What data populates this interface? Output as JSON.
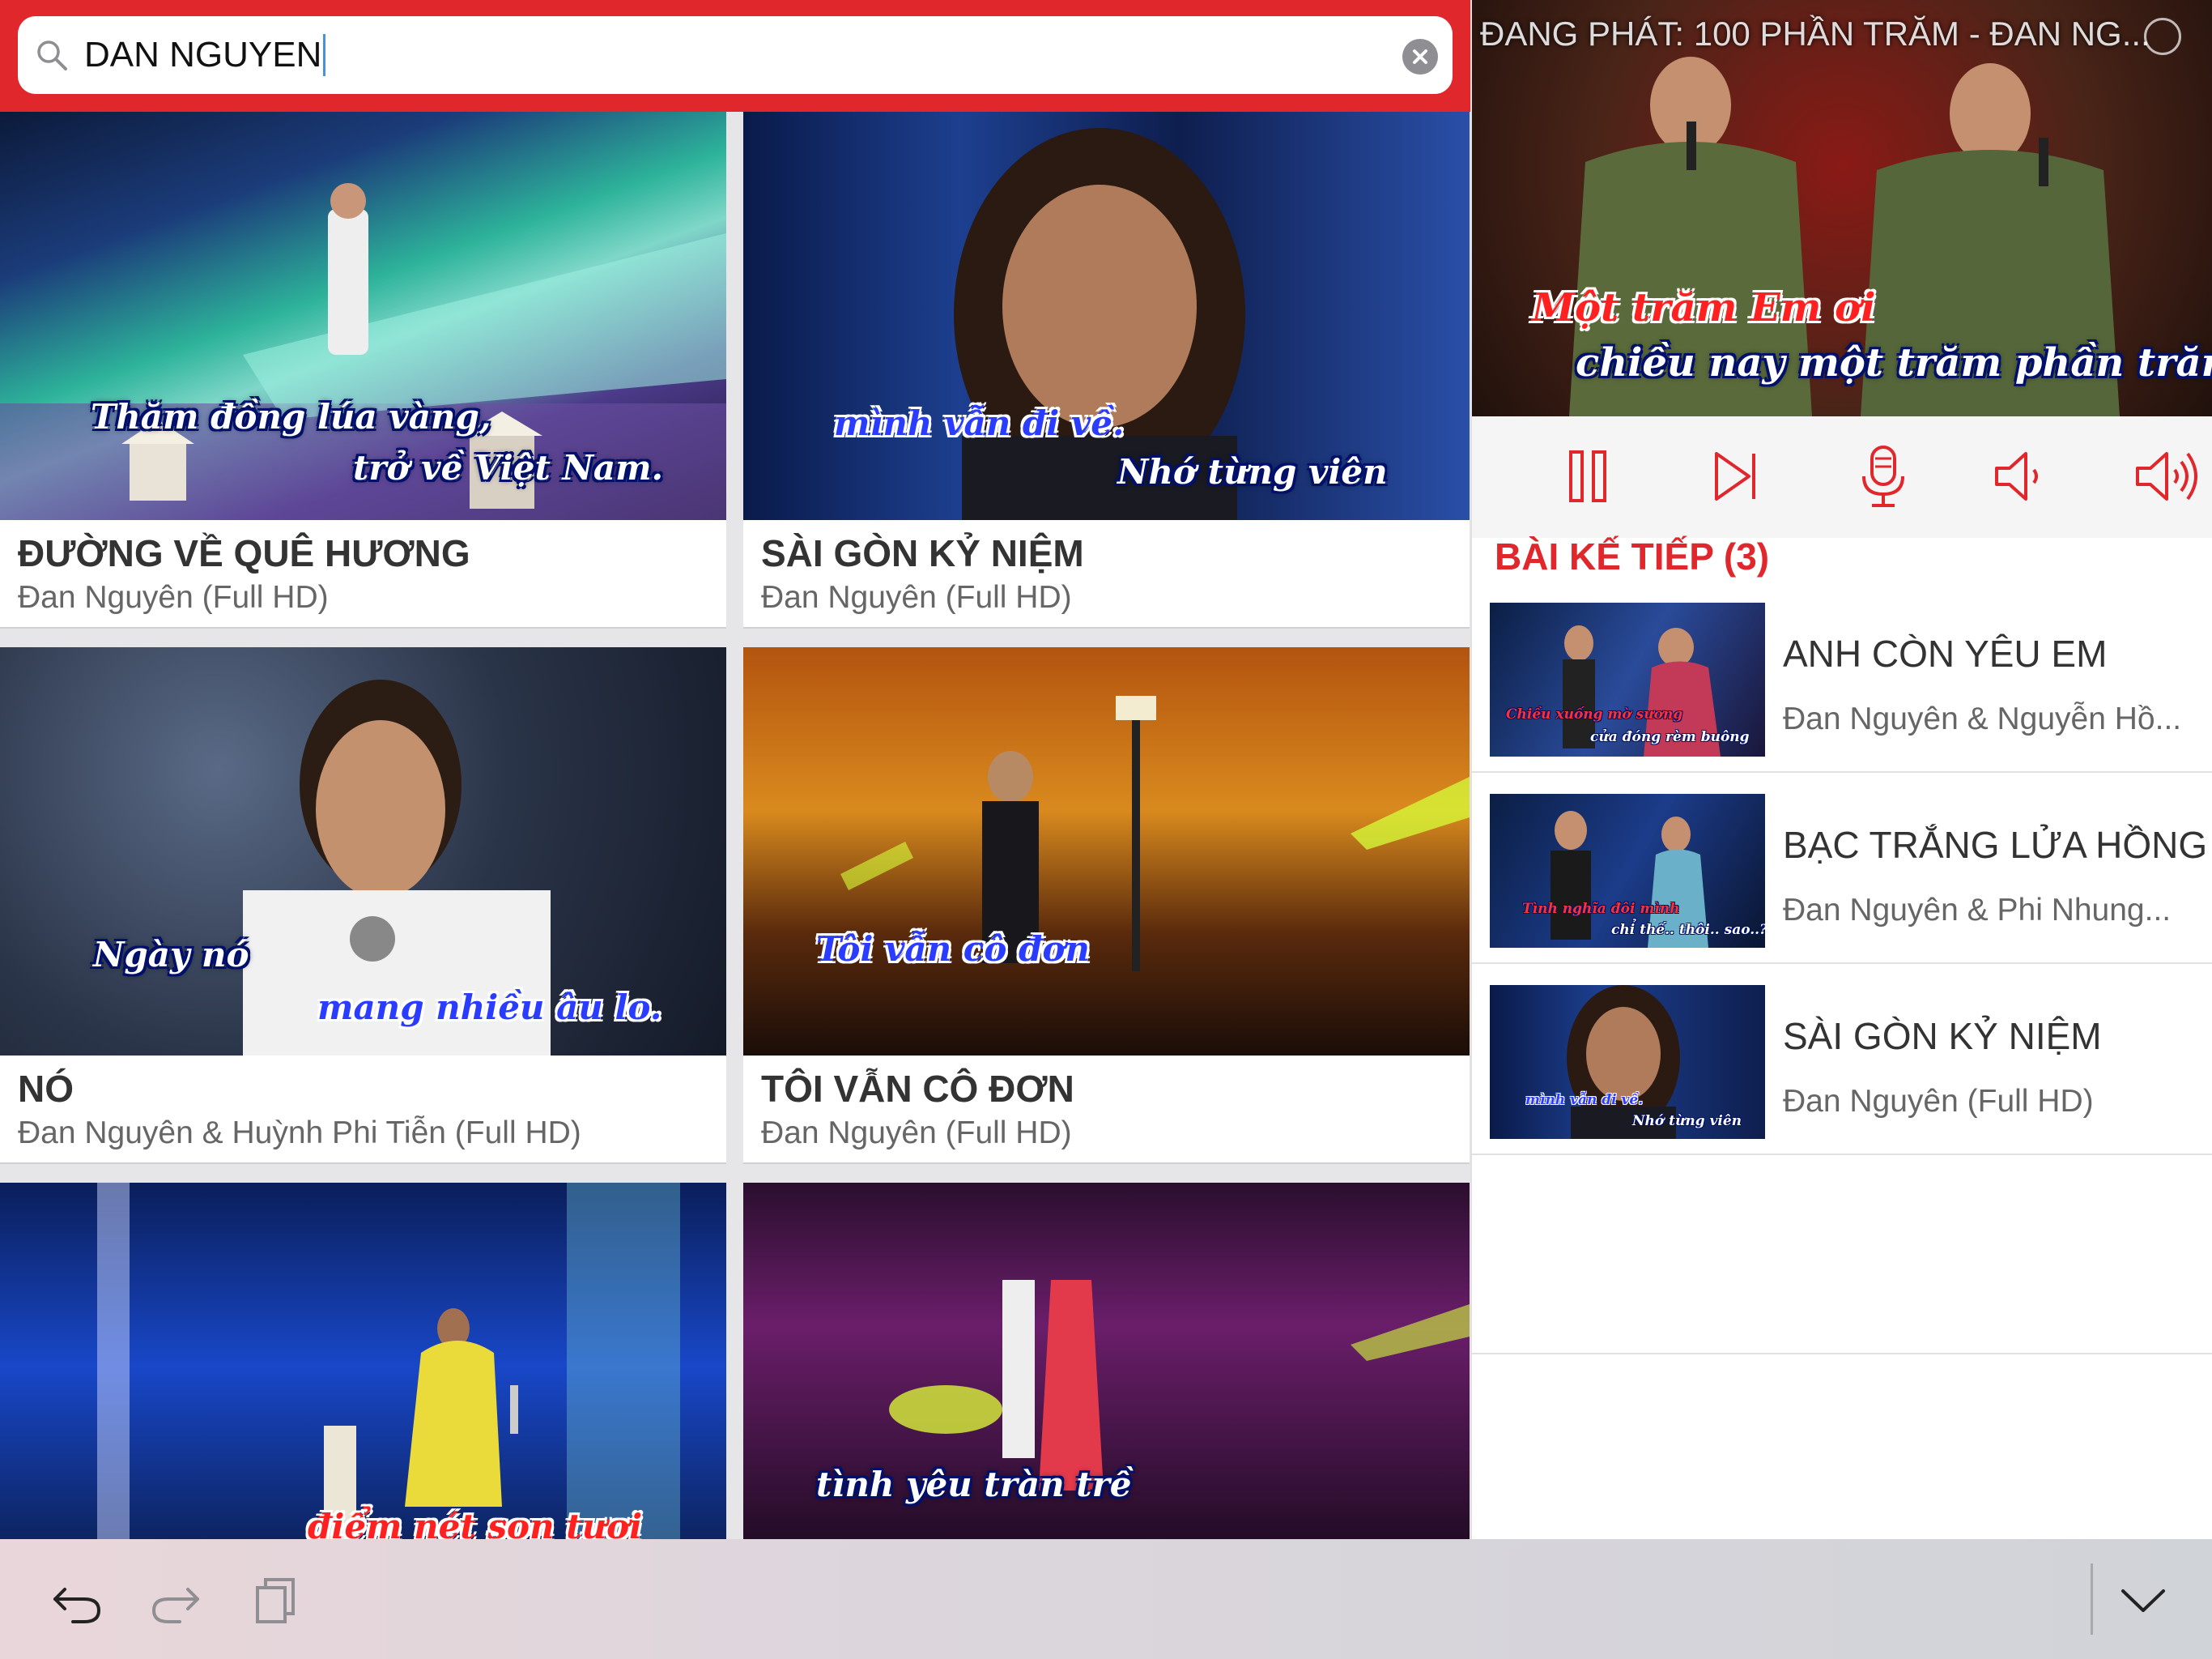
{
  "search": {
    "query": "DAN NGUYEN"
  },
  "results": [
    {
      "title": "ĐƯỜNG VỀ QUÊ HƯƠNG",
      "subtitle": "Đan Nguyên (Full HD)",
      "lyric1": "Thăm đồng lúa vàng,",
      "lyric2": "trở về Việt Nam."
    },
    {
      "title": "SÀI GÒN KỶ NIỆM",
      "subtitle": "Đan Nguyên (Full HD)",
      "lyric1": "mình vẫn đi về.",
      "lyric2": "Nhớ từng viên"
    },
    {
      "title": "NÓ",
      "subtitle": "Đan Nguyên & Huỳnh Phi Tiễn (Full HD)",
      "lyric1": "Ngày nó",
      "lyric2": "mang nhiều âu lo."
    },
    {
      "title": "TÔI VẪN CÔ ĐƠN",
      "subtitle": "Đan Nguyên (Full HD)",
      "lyric1": "Tôi vẫn cô đơn",
      "lyric2": ""
    },
    {
      "title": "",
      "subtitle": "",
      "lyric1": "điểm nét son tươi",
      "lyric2": ""
    },
    {
      "title": "",
      "subtitle": "",
      "lyric1": "tình yêu tràn trề",
      "lyric2": ""
    }
  ],
  "player": {
    "now_playing": "ĐANG PHÁT: 100 PHẦN TRĂM - ĐAN NG...",
    "lyric1": "Một trăm Em ơi",
    "lyric2": "chiều nay một trăm phần trăm."
  },
  "controls": [
    "pause-icon",
    "skip-next-icon",
    "microphone-icon",
    "volume-down-icon",
    "volume-up-icon"
  ],
  "up_next": {
    "label": "BÀI KẾ TIẾP (3)",
    "items": [
      {
        "title": "ANH CÒN YÊU EM",
        "subtitle": "Đan Nguyên & Nguyễn Hồ...",
        "lyric1": "Chiều xuống mờ sương",
        "lyric2": "cửa đóng rèm buông"
      },
      {
        "title": "BẠC TRẮNG LỬA HỒNG",
        "subtitle": "Đan Nguyên & Phi Nhung...",
        "lyric1": "Tình nghĩa đôi mình",
        "lyric2": "chỉ thế.. thôi.. sao..?"
      },
      {
        "title": "SÀI GÒN KỶ NIỆM",
        "subtitle": "Đan Nguyên (Full HD)",
        "lyric1": "mình vẫn đi về.",
        "lyric2": "Nhớ từng viên"
      }
    ]
  },
  "toolbar": [
    "undo-icon",
    "redo-icon",
    "paste-icon",
    "chevron-down-icon"
  ],
  "colors": {
    "accent": "#e0272b",
    "text": "#333333",
    "subtext": "#666666"
  }
}
